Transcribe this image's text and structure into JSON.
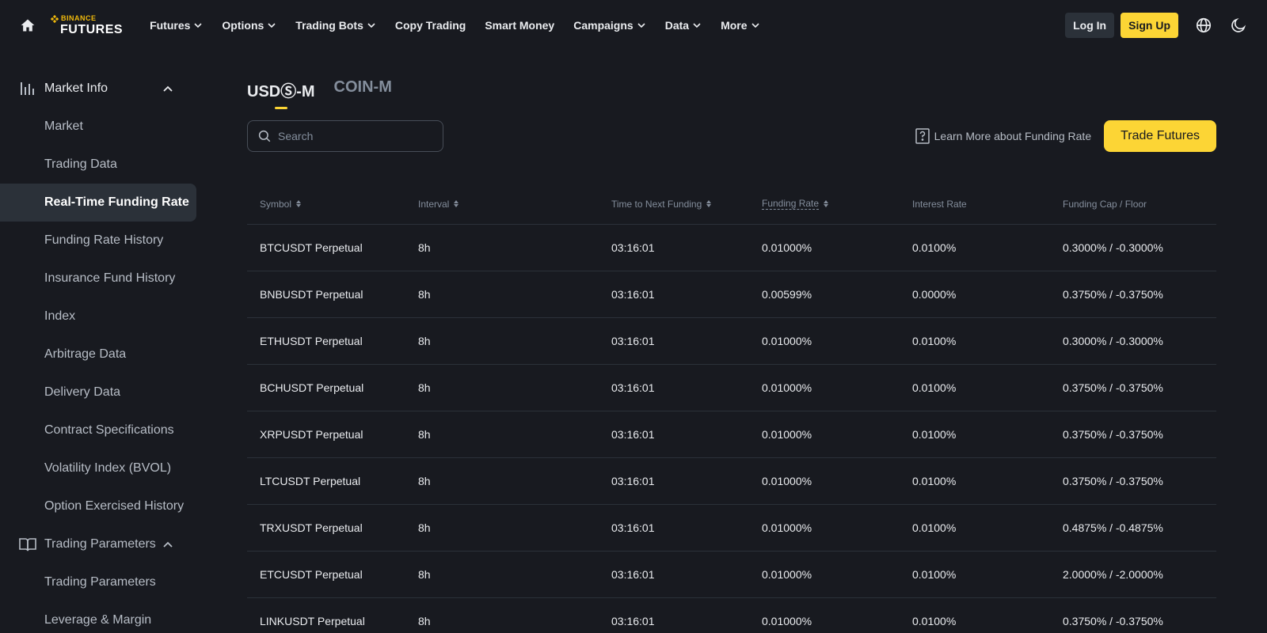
{
  "header": {
    "logo_top": "BINANCE",
    "logo_bottom": "FUTURES",
    "nav": [
      {
        "label": "Futures",
        "dropdown": true
      },
      {
        "label": "Options",
        "dropdown": true
      },
      {
        "label": "Trading Bots",
        "dropdown": true
      },
      {
        "label": "Copy Trading",
        "dropdown": false
      },
      {
        "label": "Smart Money",
        "dropdown": false
      },
      {
        "label": "Campaigns",
        "dropdown": true
      },
      {
        "label": "Data",
        "dropdown": true
      },
      {
        "label": "More",
        "dropdown": true
      }
    ],
    "login_label": "Log In",
    "signup_label": "Sign Up"
  },
  "sidebar": {
    "market_info_label": "Market Info",
    "market_info_items": [
      "Market",
      "Trading Data",
      "Real-Time Funding Rate",
      "Funding Rate History",
      "Insurance Fund History",
      "Index",
      "Arbitrage Data",
      "Delivery Data",
      "Contract Specifications",
      "Volatility Index (BVOL)",
      "Option Exercised History"
    ],
    "active_item": "Real-Time Funding Rate",
    "trading_params_label": "Trading Parameters",
    "trading_params_items": [
      "Trading Parameters",
      "Leverage & Margin"
    ]
  },
  "main": {
    "tabs": [
      {
        "label": "USDⓈ-M",
        "active": true
      },
      {
        "label": "COIN-M",
        "active": false
      }
    ],
    "search_placeholder": "Search",
    "learn_more_label": "Learn More about Funding Rate",
    "trade_button_label": "Trade Futures"
  },
  "table": {
    "headers": {
      "symbol": "Symbol",
      "interval": "Interval",
      "time_to_next": "Time to Next Funding",
      "funding_rate": "Funding Rate",
      "interest_rate": "Interest Rate",
      "cap_floor": "Funding Cap / Floor"
    },
    "rows": [
      {
        "symbol": "BTCUSDT Perpetual",
        "interval": "8h",
        "time": "03:16:01",
        "funding": "0.01000%",
        "interest": "0.0100%",
        "cap": "0.3000% / -0.3000%"
      },
      {
        "symbol": "BNBUSDT Perpetual",
        "interval": "8h",
        "time": "03:16:01",
        "funding": "0.00599%",
        "interest": "0.0000%",
        "cap": "0.3750% / -0.3750%"
      },
      {
        "symbol": "ETHUSDT Perpetual",
        "interval": "8h",
        "time": "03:16:01",
        "funding": "0.01000%",
        "interest": "0.0100%",
        "cap": "0.3000% / -0.3000%"
      },
      {
        "symbol": "BCHUSDT Perpetual",
        "interval": "8h",
        "time": "03:16:01",
        "funding": "0.01000%",
        "interest": "0.0100%",
        "cap": "0.3750% / -0.3750%"
      },
      {
        "symbol": "XRPUSDT Perpetual",
        "interval": "8h",
        "time": "03:16:01",
        "funding": "0.01000%",
        "interest": "0.0100%",
        "cap": "0.3750% / -0.3750%"
      },
      {
        "symbol": "LTCUSDT Perpetual",
        "interval": "8h",
        "time": "03:16:01",
        "funding": "0.01000%",
        "interest": "0.0100%",
        "cap": "0.3750% / -0.3750%"
      },
      {
        "symbol": "TRXUSDT Perpetual",
        "interval": "8h",
        "time": "03:16:01",
        "funding": "0.01000%",
        "interest": "0.0100%",
        "cap": "0.4875% / -0.4875%"
      },
      {
        "symbol": "ETCUSDT Perpetual",
        "interval": "8h",
        "time": "03:16:01",
        "funding": "0.01000%",
        "interest": "0.0100%",
        "cap": "2.0000% / -2.0000%"
      },
      {
        "symbol": "LINKUSDT Perpetual",
        "interval": "8h",
        "time": "03:16:01",
        "funding": "0.01000%",
        "interest": "0.0100%",
        "cap": "0.3750% / -0.3750%"
      }
    ]
  },
  "colors": {
    "background": "#181a20",
    "accent": "#fcd535",
    "brand": "#f0b90b",
    "panel": "#2b3139"
  },
  "icons": [
    "home-icon",
    "binance-logo-icon",
    "chevron-down-icon",
    "globe-icon",
    "moon-icon",
    "bar-chart-icon",
    "chevron-up-icon",
    "book-icon",
    "search-icon",
    "question-doc-icon",
    "sort-icon"
  ]
}
